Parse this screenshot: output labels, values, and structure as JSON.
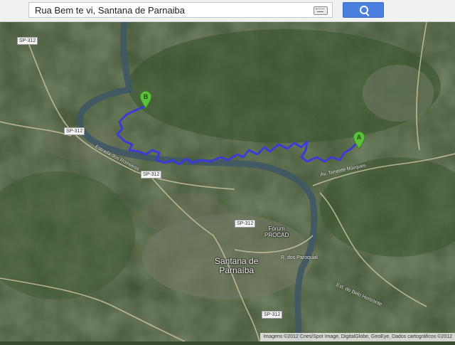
{
  "search": {
    "query": "Rua Bem te vi, Santana de Parnaiba",
    "keyboard_icon": "keyboard-icon",
    "button_icon": "search-icon"
  },
  "markers": {
    "a": {
      "label": "A",
      "color": "#5cbf3a"
    },
    "b": {
      "label": "B",
      "color": "#5cbf3a"
    }
  },
  "route": {
    "color": "#3b3bd6"
  },
  "roads": [
    {
      "label": "SP-312"
    },
    {
      "label": "SP-312"
    },
    {
      "label": "SP-312"
    },
    {
      "label": "SP-312"
    },
    {
      "label": "SP-312"
    }
  ],
  "places": {
    "city": "Santana de\nParnaíba",
    "forum": "Fórum\nPROCAD"
  },
  "streets": [
    "Estrada dos Romeiros",
    "Av. Tenente Marques",
    "Est. do Belo Horizonte",
    "R. dos Paroquial"
  ],
  "attribution": "Imagens ©2012 Cnes/Spot Image, DigitalGlobe, GeoEye, Dados cartográficos ©2012"
}
